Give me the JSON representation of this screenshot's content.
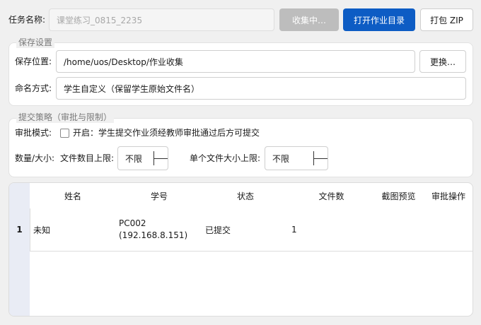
{
  "task": {
    "label": "任务名称:",
    "value": "课堂练习_0815_2235",
    "collecting_label": "收集中…",
    "open_dir_label": "打开作业目录",
    "zip_label": "打包 ZIP"
  },
  "save_settings": {
    "title": "保存设置",
    "location_label": "保存位置:",
    "location_value": "/home/uos/Desktop/作业收集",
    "change_label": "更换…",
    "naming_label": "命名方式:",
    "naming_value": "学生自定义（保留学生原始文件名）"
  },
  "policy": {
    "title": "提交策略（审批与限制）",
    "approval_label": "审批模式:",
    "approval_checked": false,
    "approval_text": "开启：学生提交作业须经教师审批通过后方可提交",
    "qty_label": "数量/大小:",
    "file_count_label": "文件数目上限:",
    "file_count_value": "不限",
    "file_size_label": "单个文件大小上限:",
    "file_size_value": "不限"
  },
  "table": {
    "headers": [
      "姓名",
      "学号",
      "状态",
      "文件数",
      "截图预览",
      "审批操作"
    ],
    "rows": [
      {
        "index": "1",
        "name": "未知",
        "id_line1": "PC002",
        "id_line2": "(192.168.8.151)",
        "status": "已提交",
        "files": "1",
        "preview": "",
        "action": ""
      }
    ]
  },
  "colors": {
    "primary": "#0d5cc4",
    "disabled_button": "#bdbdbd",
    "row_header": "#e9ecf5"
  }
}
